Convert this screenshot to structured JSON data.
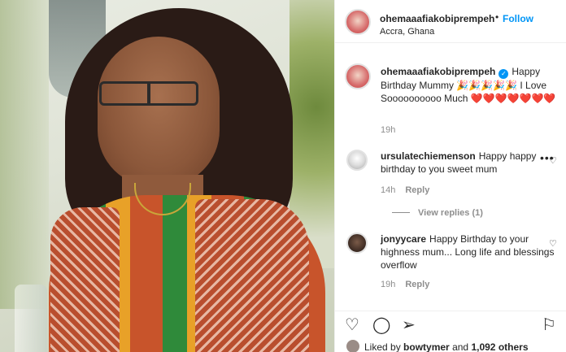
{
  "post": {
    "username": "ohemaaafiakobiprempeh",
    "follow_label": "Follow",
    "dot": "•",
    "location": "Accra, Ghana"
  },
  "caption": {
    "username": "ohemaaafiakobiprempeh",
    "text": "Happy Birthday Mummy 🎉🎉🎉🎉🎉 I Love Soooooooooo Much ❤️❤️❤️❤️❤️❤️❤️",
    "time": "19h"
  },
  "comments": [
    {
      "username": "ursulatechiemenson",
      "text": "Happy happy birthday to you sweet mum",
      "time": "14h",
      "reply_label": "Reply",
      "view_replies": "View replies (1)"
    },
    {
      "username": "jonyycare",
      "text": "Happy Birthday to your highness mum... Long life and blessings overflow",
      "time": "19h",
      "reply_label": "Reply"
    }
  ],
  "icons": {
    "more": "more-horizontal-icon",
    "like": "heart-icon",
    "comment": "comment-icon",
    "share": "share-icon",
    "save": "bookmark-icon"
  },
  "likes": {
    "prefix": "Liked by",
    "user": "bowtymer",
    "middle": "and",
    "count": "1,092 others"
  },
  "colors": {
    "follow": "#0095f6",
    "verified": "#0095f6",
    "heart": "#ed4956"
  }
}
